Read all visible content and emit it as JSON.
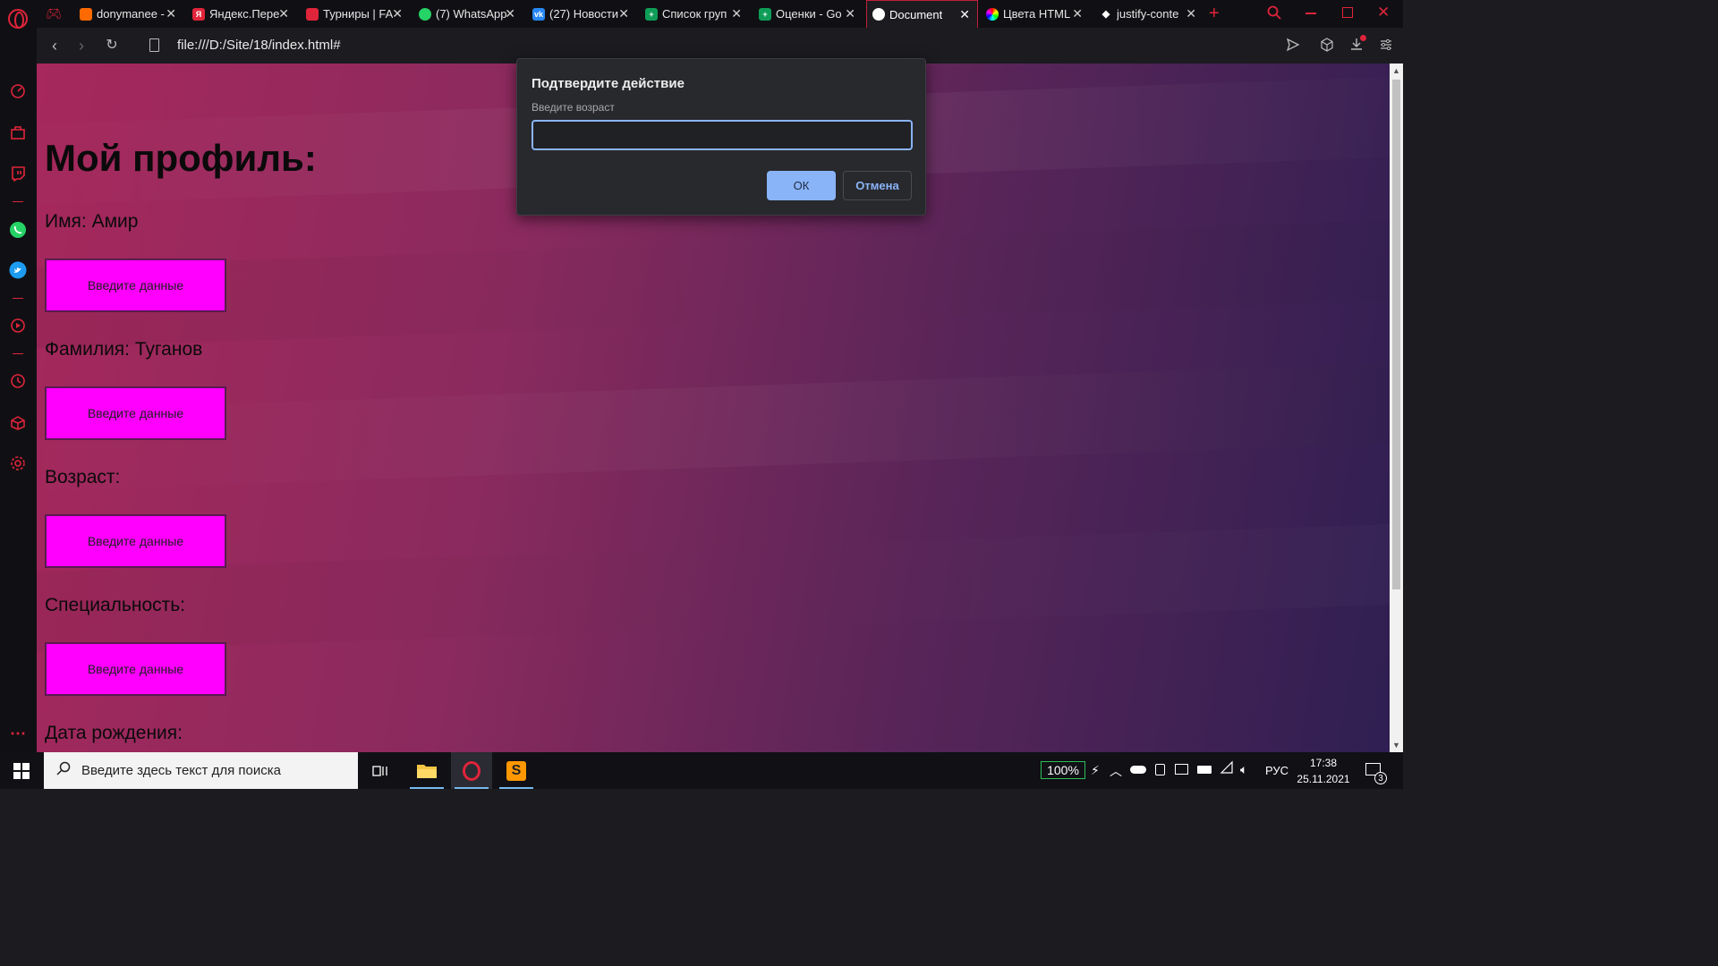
{
  "tabs": [
    {
      "title": "donymanee -",
      "icon_color": "#ff6a00",
      "icon": "twitch-wave-icon"
    },
    {
      "title": "Яндекс.Пере",
      "icon_color": "#e0243a",
      "icon": "yandex-translate-icon"
    },
    {
      "title": "Турниры | FA",
      "icon_color": "#e0243a",
      "icon": "shield-icon"
    },
    {
      "title": "(7) WhatsApp",
      "icon_color": "#25d366",
      "icon": "whatsapp-icon"
    },
    {
      "title": "(27) Новости",
      "icon_color": "#2787f5",
      "icon": "vk-icon"
    },
    {
      "title": "Список груп",
      "icon_color": "#0f9d58",
      "icon": "sheets-icon"
    },
    {
      "title": "Оценки - Go",
      "icon_color": "#0f9d58",
      "icon": "sheets-icon"
    },
    {
      "title": "Document",
      "icon_color": "#ffffff",
      "icon": "globe-icon"
    },
    {
      "title": "Цвета HTML",
      "icon_color": "#ff00aa",
      "icon": "color-wheel-icon"
    },
    {
      "title": "justify-conte",
      "icon_color": "#ffffff",
      "icon": "graduation-cap-icon"
    }
  ],
  "address": {
    "url": "file:///D:/Site/18/index.html#"
  },
  "page": {
    "heading": "Мой профиль:",
    "fields": [
      {
        "label": "Имя: Амир",
        "button": "Введите данные"
      },
      {
        "label": "Фамилия: Туганов",
        "button": "Введите данные"
      },
      {
        "label": "Возраст:",
        "button": "Введите данные"
      },
      {
        "label": "Специальность:",
        "button": "Введите данные"
      },
      {
        "label": "Дата рождения:"
      }
    ]
  },
  "dialog": {
    "title": "Подтвердите действие",
    "message": "Введите возраст",
    "input_value": "",
    "ok": "ОК",
    "cancel": "Отмена"
  },
  "taskbar": {
    "search_placeholder": "Введите здесь текст для поиска",
    "battery": "100%",
    "language": "РУС",
    "time": "17:38",
    "date": "25.11.2021",
    "notifications": "3"
  },
  "colors": {
    "accent": "#e0243a",
    "button_bg": "#ff00ff",
    "dialog_accent": "#8ab4f8"
  }
}
